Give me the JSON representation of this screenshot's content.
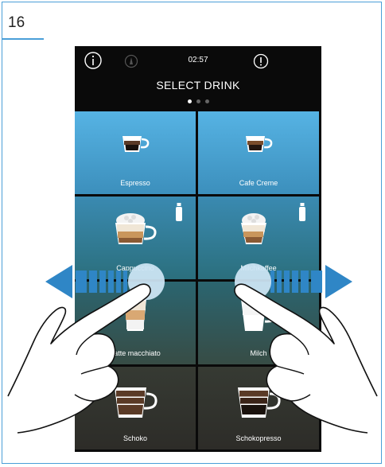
{
  "figure_number": "16",
  "header": {
    "time": "02:57",
    "title": "SELECT DRINK"
  },
  "pagination": {
    "pages": 3,
    "current": 1
  },
  "drinks": [
    {
      "label": "Espresso",
      "milk": false
    },
    {
      "label": "Cafe Creme",
      "milk": false
    },
    {
      "label": "Cappuccino",
      "milk": true
    },
    {
      "label": "Milchkaffee",
      "milk": true
    },
    {
      "label": "Latte macchiato",
      "milk": false
    },
    {
      "label": "Milch",
      "milk": false
    },
    {
      "label": "Schoko",
      "milk": false
    },
    {
      "label": "Schokopresso",
      "milk": false
    }
  ],
  "colors": {
    "accent": "#4a9fd8",
    "swipe_arrow": "#2f86c6",
    "screen_bg": "#0a0a0a"
  }
}
